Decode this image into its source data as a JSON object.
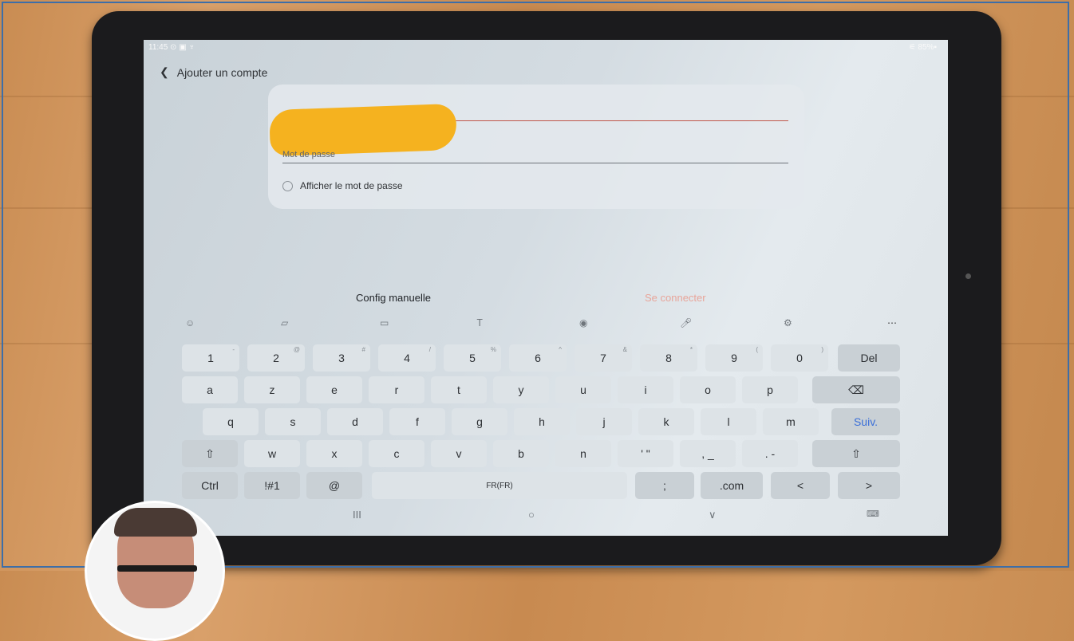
{
  "status_bar": {
    "time": "11:45 ⊙ ▣ ♆",
    "battery": "⚟ 85%▪"
  },
  "app_bar": {
    "back_icon": "chevron-left-icon",
    "title": "Ajouter un compte"
  },
  "form": {
    "email_value_redacted": true,
    "password_label": "Mot de passe",
    "show_password_label": "Afficher le mot de passe",
    "show_password_checked": false
  },
  "actions": {
    "manual_config": "Config manuelle",
    "login": "Se connecter"
  },
  "keyboard_toolbar": {
    "icons": [
      "emoji-icon",
      "sticker-icon",
      "gif-icon",
      "handwriting-icon",
      "translate-icon",
      "mic-icon",
      "settings-icon",
      "more-icon"
    ]
  },
  "keyboard": {
    "row1": [
      {
        "label": "1",
        "sub": "-"
      },
      {
        "label": "2",
        "sub": "@"
      },
      {
        "label": "3",
        "sub": "#"
      },
      {
        "label": "4",
        "sub": "/"
      },
      {
        "label": "5",
        "sub": "%"
      },
      {
        "label": "6",
        "sub": "^"
      },
      {
        "label": "7",
        "sub": "&"
      },
      {
        "label": "8",
        "sub": "*"
      },
      {
        "label": "9",
        "sub": "("
      },
      {
        "label": "0",
        "sub": ")"
      },
      {
        "label": "Del",
        "sub": ""
      }
    ],
    "row2": [
      "a",
      "z",
      "e",
      "r",
      "t",
      "y",
      "u",
      "i",
      "o",
      "p",
      "⌫"
    ],
    "row3": [
      "q",
      "s",
      "d",
      "f",
      "g",
      "h",
      "j",
      "k",
      "l",
      "m",
      "Suiv."
    ],
    "row4": [
      "⇧",
      "w",
      "x",
      "c",
      "v",
      "b",
      "n",
      "' \"",
      ", _",
      ". -",
      "⇧"
    ],
    "row5": [
      "Ctrl",
      "!#1",
      "@",
      "FR(FR)",
      ";",
      ".com",
      "<",
      ">"
    ]
  },
  "navbar": {
    "recent": "III",
    "home": "○",
    "back": "∨",
    "keyboard": "⌨"
  },
  "colors": {
    "accent_red": "#c0564a",
    "next_blue": "#3a6fd8",
    "redaction": "#f5b21f"
  }
}
